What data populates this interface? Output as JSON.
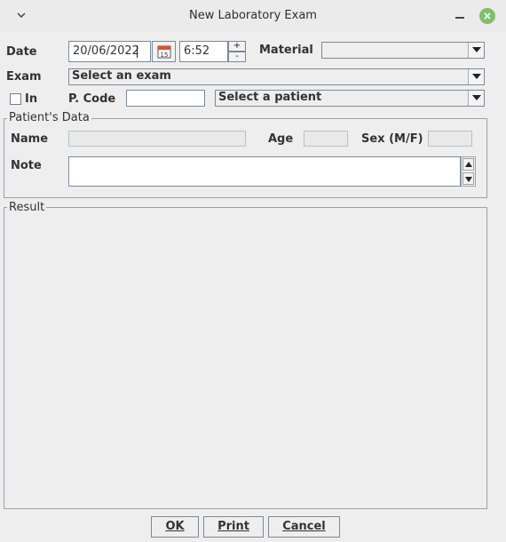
{
  "window": {
    "title": "New Laboratory Exam",
    "menu_icon": "chevron-down-icon",
    "minimize_icon": "minimize-icon",
    "close_icon": "close-icon",
    "close_color": "#7fbf6a"
  },
  "form": {
    "date_label": "Date",
    "date_value": "20/06/2022",
    "calendar_icon": "calendar-icon",
    "calendar_day": "15",
    "time_value": "6:52",
    "spinner_up": "+",
    "spinner_down": "-",
    "material_label": "Material",
    "material_value": "",
    "exam_label": "Exam",
    "exam_value": "Select an exam",
    "in_label": "In",
    "in_checked": false,
    "pcode_label": "P. Code",
    "pcode_value": "",
    "patient_value": "Select a patient"
  },
  "patient_data": {
    "title": "Patient's Data",
    "name_label": "Name",
    "name_value": "",
    "age_label": "Age",
    "age_value": "",
    "sex_label": "Sex (M/F)",
    "sex_value": "",
    "note_label": "Note",
    "note_value": ""
  },
  "result": {
    "title": "Result"
  },
  "buttons": {
    "ok": "OK",
    "print": "Print",
    "cancel": "Cancel"
  }
}
